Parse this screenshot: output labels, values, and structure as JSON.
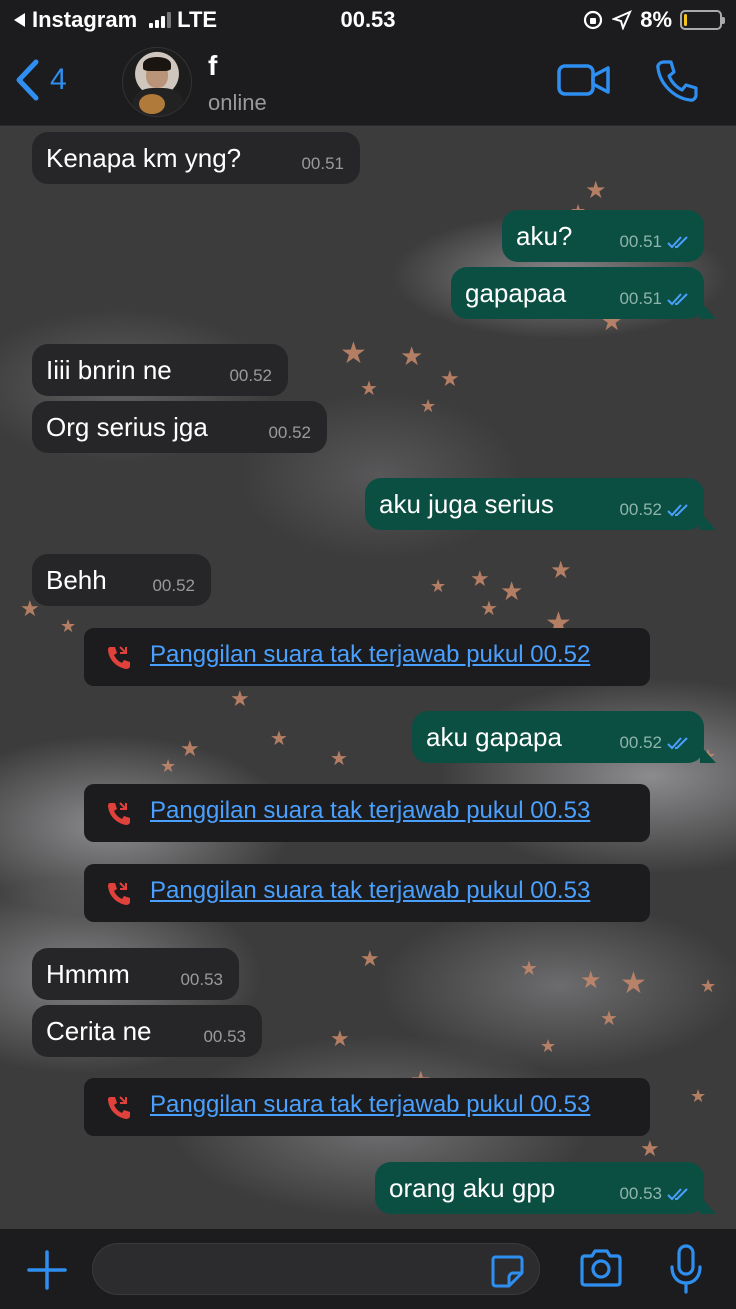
{
  "status_bar": {
    "back_app": "Instagram",
    "network": "LTE",
    "time": "00.53",
    "battery": "8%",
    "battery_level": 0.08
  },
  "header": {
    "back_count": "4",
    "contact_name": "f",
    "contact_status": "online"
  },
  "messages": [
    {
      "dir": "in",
      "text": "Kenapa km yng?",
      "time": "00.51"
    },
    {
      "dir": "out",
      "text": "aku?",
      "time": "00.51"
    },
    {
      "dir": "out",
      "text": "gapapaa",
      "time": "00.51"
    },
    {
      "dir": "in",
      "text": "Iiii bnrin ne",
      "time": "00.52"
    },
    {
      "dir": "in",
      "text": "Org serius jga",
      "time": "00.52"
    },
    {
      "dir": "out",
      "text": "aku juga serius",
      "time": "00.52"
    },
    {
      "dir": "in",
      "text": "Behh",
      "time": "00.52"
    },
    {
      "dir": "call",
      "text": "Panggilan suara tak terjawab pukul 00.52"
    },
    {
      "dir": "out",
      "text": "aku gapapa",
      "time": "00.52"
    },
    {
      "dir": "call",
      "text": "Panggilan suara tak terjawab pukul 00.53"
    },
    {
      "dir": "call",
      "text": "Panggilan suara tak terjawab pukul 00.53"
    },
    {
      "dir": "in",
      "text": "Hmmm",
      "time": "00.53"
    },
    {
      "dir": "in",
      "text": "Cerita ne",
      "time": "00.53"
    },
    {
      "dir": "call",
      "text": "Panggilan suara tak terjawab pukul 00.53"
    },
    {
      "dir": "out",
      "text": "orang aku gpp",
      "time": "00.53"
    }
  ],
  "colors": {
    "accent": "#2f8ff0",
    "outgoing_bubble": "#0b4f43",
    "incoming_bubble": "#262628",
    "missed_call_icon": "#e0413a",
    "link": "#4aa0ff"
  },
  "icons": {
    "back": "chevron-left-icon",
    "video": "video-camera-icon",
    "phone": "phone-icon",
    "add": "plus-icon",
    "sticker": "sticker-icon",
    "camera": "camera-icon",
    "mic": "microphone-icon",
    "missed_call": "missed-call-icon",
    "read": "double-check-icon"
  }
}
